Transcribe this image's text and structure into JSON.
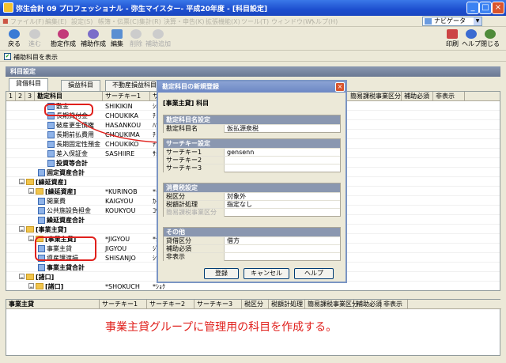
{
  "window": {
    "title": "弥生会計 09 プロフェッショナル - 弥生マイスター- 平成20年度 - [科目設定]"
  },
  "menu": [
    "ファイル(F)",
    "編集(E)",
    "設定(S)",
    "帳簿・伝票(C)",
    "集計(R)",
    "決算・申告(K)",
    "拡張機能(X)",
    "ツール(T)",
    "ウィンドウ(W)",
    "ヘルプ(H)"
  ],
  "navi": {
    "label": "ナビゲータ"
  },
  "toolbar": {
    "left": [
      {
        "label": "戻る",
        "icon": "back-icon",
        "enabled": true
      },
      {
        "label": "進む",
        "icon": "forward-icon",
        "enabled": false
      },
      {
        "label": "勘定作成",
        "icon": "create-account-icon",
        "enabled": true
      },
      {
        "label": "補助作成",
        "icon": "create-sub-icon",
        "enabled": true
      },
      {
        "label": "編集",
        "icon": "edit-icon",
        "enabled": true
      },
      {
        "label": "削除",
        "icon": "delete-icon",
        "enabled": false
      },
      {
        "label": "補助追加",
        "icon": "add-sub-icon",
        "enabled": false
      }
    ],
    "right": [
      {
        "label": "印刷",
        "icon": "print-icon",
        "enabled": true
      },
      {
        "label": "ヘルプ",
        "icon": "help-icon",
        "enabled": true
      },
      {
        "label": "閉じる",
        "icon": "close-icon",
        "enabled": true
      }
    ]
  },
  "show_sub_accounts": {
    "label": "補助科目を表示",
    "checked": true
  },
  "section_title": "科目設定",
  "tabs": [
    "貸借科目",
    "損益科目",
    "不動産損益科目"
  ],
  "grid": {
    "levels": [
      "1",
      "2",
      "3"
    ],
    "headers": [
      "勘定科目",
      "サーチキー1",
      "サ",
      "簡易課税事業区分",
      "補助必須",
      "非表示"
    ],
    "rows": [
      {
        "indent": 3,
        "icon": "doc",
        "name": "敷金",
        "key": "SHIKIKIN",
        "k2": "ｼｷｷﾝ",
        "bold": false
      },
      {
        "indent": 3,
        "icon": "doc",
        "name": "長期貸付金",
        "key": "CHOUKIKA",
        "k2": "ﾁｮｳｷ",
        "bold": false
      },
      {
        "indent": 3,
        "icon": "doc",
        "name": "破産更生債権",
        "key": "HASANKOU",
        "k2": "ﾊｻﾝ",
        "bold": false
      },
      {
        "indent": 3,
        "icon": "doc",
        "name": "長期前払費用",
        "key": "CHOUKIMA",
        "k2": "ﾁｮｳｷ",
        "bold": false
      },
      {
        "indent": 3,
        "icon": "doc",
        "name": "長期固定性預金",
        "key": "CHOUKIKO",
        "k2": "ﾁｮｳｷ",
        "bold": false
      },
      {
        "indent": 3,
        "icon": "doc",
        "name": "差入保証金",
        "key": "SASHIIRE",
        "k2": "ｻｼｲ",
        "bold": false
      },
      {
        "indent": 3,
        "icon": "doc",
        "name": "投資等合計",
        "key": "",
        "k2": "",
        "bold": true
      },
      {
        "indent": 2,
        "icon": "doc",
        "name": "固定資産合計",
        "key": "",
        "k2": "",
        "bold": true
      },
      {
        "indent": 0,
        "icon": "folder",
        "name": "[繰延資産]",
        "key": "",
        "k2": "",
        "bold": true,
        "exp": "−"
      },
      {
        "indent": 1,
        "icon": "folder",
        "name": "[繰延資産]",
        "key": "*KURINOB",
        "k2": "*ｸﾘﾉ",
        "bold": true,
        "exp": "−"
      },
      {
        "indent": 2,
        "icon": "doc",
        "name": "開業費",
        "key": "KAIGYOU",
        "k2": "ｶｲｷﾞ",
        "bold": false
      },
      {
        "indent": 2,
        "icon": "doc",
        "name": "公共施設負担金",
        "key": "KOUKYOU",
        "k2": "ｺｳｷ",
        "bold": false
      },
      {
        "indent": 2,
        "icon": "doc",
        "name": "繰延資産合計",
        "key": "",
        "k2": "",
        "bold": true
      },
      {
        "indent": 0,
        "icon": "folder",
        "name": "[事業主貸]",
        "key": "",
        "k2": "",
        "bold": true,
        "exp": "−"
      },
      {
        "indent": 1,
        "icon": "folder",
        "name": "[事業主貸]",
        "key": "*JIGYOU",
        "k2": "*ｼﾞｷﾞ",
        "bold": true,
        "exp": "−"
      },
      {
        "indent": 2,
        "icon": "doc",
        "name": "事業主貸",
        "key": "JIGYOU",
        "k2": "ｼﾞｷﾞ",
        "bold": false
      },
      {
        "indent": 2,
        "icon": "doc",
        "name": "資産譲渡損",
        "key": "SHISANJO",
        "k2": "ｼｻﾝ",
        "bold": false
      },
      {
        "indent": 2,
        "icon": "doc",
        "name": "事業主貸合計",
        "key": "",
        "k2": "",
        "bold": true
      },
      {
        "indent": 0,
        "icon": "folder",
        "name": "[諸口]",
        "key": "",
        "k2": "",
        "bold": true,
        "exp": "−"
      },
      {
        "indent": 1,
        "icon": "folder",
        "name": "[諸口]",
        "key": "*SHOKUCH",
        "k2": "*ｼｮｸ",
        "bold": true,
        "exp": "−"
      }
    ]
  },
  "bottom": {
    "headers": [
      "事業主貸",
      "サーチキー1",
      "サーチキー2",
      "サーチキー3",
      "税区分",
      "税額計処理",
      "簡易課税事業区分",
      "補助必須",
      "非表示"
    ],
    "caption": "事業主貸グループに管理用の科目を作成する。"
  },
  "dialog": {
    "title": "勘定科目の新規登録",
    "heading": "[事業主貸] 科目",
    "groups": [
      {
        "title": "勘定科目名設定",
        "rows": [
          {
            "k": "勘定科目名",
            "v": "仮払源泉税"
          }
        ]
      },
      {
        "title": "サーチキー設定",
        "rows": [
          {
            "k": "サーチキー1",
            "v": "gensenn"
          },
          {
            "k": "サーチキー2",
            "v": ""
          },
          {
            "k": "サーチキー3",
            "v": ""
          }
        ]
      },
      {
        "title": "消費税設定",
        "rows": [
          {
            "k": "税区分",
            "v": "対象外"
          },
          {
            "k": "税額計処理",
            "v": "指定なし"
          },
          {
            "k": "簡易課税事業区分",
            "v": "",
            "disabled": true
          }
        ]
      },
      {
        "title": "その他",
        "rows": [
          {
            "k": "貸借区分",
            "v": "借方"
          },
          {
            "k": "補助必須",
            "v": ""
          },
          {
            "k": "非表示",
            "v": ""
          }
        ]
      }
    ],
    "buttons": {
      "ok": "登録",
      "cancel": "キャンセル",
      "help": "ヘルプ"
    }
  },
  "colors": {
    "accent_red": "#e0201c",
    "title_blue": "#1d4fcf"
  }
}
